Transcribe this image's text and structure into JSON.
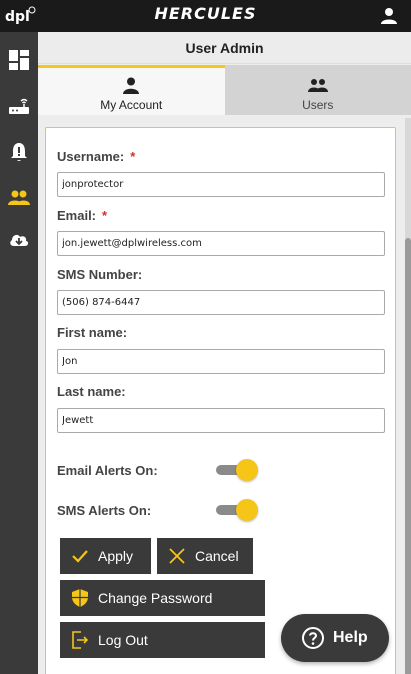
{
  "app": {
    "logo_text": "dpl",
    "brand": "HERCULES"
  },
  "sidebar": {
    "items": [
      {
        "icon": "dashboard-icon",
        "active": false
      },
      {
        "icon": "router-icon",
        "active": false
      },
      {
        "icon": "alarm-bell-icon",
        "active": false
      },
      {
        "icon": "users-icon",
        "active": true
      },
      {
        "icon": "cloud-download-icon",
        "active": false
      }
    ]
  },
  "header": {
    "title": "User Admin"
  },
  "tabs": [
    {
      "label": "My Account",
      "icon": "person-icon",
      "active": true
    },
    {
      "label": "Users",
      "icon": "group-icon",
      "active": false
    }
  ],
  "form": {
    "username": {
      "label": "Username:",
      "required": "*",
      "value": "jonprotector"
    },
    "email": {
      "label": "Email:",
      "required": "*",
      "value": "jon.jewett@dplwireless.com"
    },
    "sms": {
      "label": "SMS Number:",
      "value": "(506) 874-6447"
    },
    "first_name": {
      "label": "First name:",
      "value": "Jon"
    },
    "last_name": {
      "label": "Last name:",
      "value": "Jewett"
    },
    "email_alerts": {
      "label": "Email Alerts On:",
      "on": true
    },
    "sms_alerts": {
      "label": "SMS Alerts On:",
      "on": true
    }
  },
  "buttons": {
    "apply": "Apply",
    "cancel": "Cancel",
    "change_password": "Change Password",
    "logout": "Log Out"
  },
  "help": {
    "label": "Help"
  },
  "colors": {
    "accent": "#f5c518",
    "dark": "#3a3a3a",
    "required": "#d32f2f"
  }
}
